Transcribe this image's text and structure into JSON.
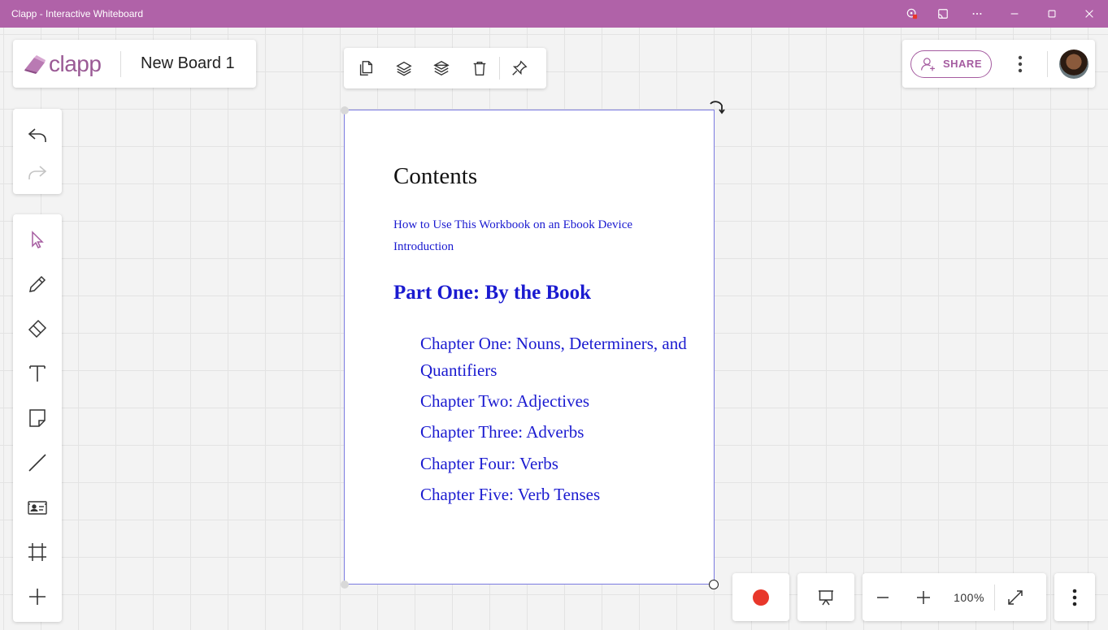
{
  "window": {
    "title": "Clapp - Interactive Whiteboard"
  },
  "brand": {
    "logo_text": "clapp",
    "board_name": "New Board 1",
    "accent_color": "#b062a8"
  },
  "object_toolbar": {
    "icons": [
      "duplicate-icon",
      "bring-forward-icon",
      "send-backward-icon",
      "delete-icon",
      "pin-icon"
    ]
  },
  "share": {
    "label": "SHARE"
  },
  "history": {
    "icons": [
      "undo-icon",
      "redo-icon"
    ]
  },
  "tools": {
    "icons": [
      "select-icon",
      "pen-icon",
      "eraser-icon",
      "text-icon",
      "sticky-note-icon",
      "line-icon",
      "media-card-icon",
      "frame-icon",
      "add-icon"
    ]
  },
  "document": {
    "title": "Contents",
    "links": [
      "How to Use This Workbook on an Ebook Device",
      "Introduction"
    ],
    "part": "Part One: By the Book",
    "chapters": [
      "Chapter One: Nouns, Determiners, and Quantifiers",
      "Chapter Two: Adjectives",
      "Chapter Three: Adverbs",
      "Chapter Four: Verbs",
      "Chapter Five: Verb Tenses"
    ],
    "link_color": "#1a1ad0"
  },
  "bottom_bar": {
    "zoom_level": "100%",
    "record_color": "#e8372b"
  }
}
